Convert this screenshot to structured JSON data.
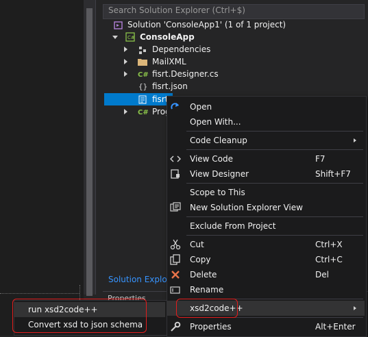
{
  "solution_explorer": {
    "search_placeholder": "Search Solution Explorer (Ctrl+$)",
    "bottom_tab": "Solution Explore",
    "properties_label": "Properties",
    "tree": {
      "solution": "Solution 'ConsoleApp1' (1 of 1 project)",
      "project": "ConsoleApp",
      "dependencies": "Dependencies",
      "mailxml": "MailXML",
      "designer": "fisrt.Designer.cs",
      "json": "fisrt.json",
      "selected": "fisrt",
      "program": "Prog"
    }
  },
  "context_menu": {
    "open": "Open",
    "open_with": "Open With...",
    "code_cleanup": "Code Cleanup",
    "view_code": "View Code",
    "view_code_sc": "F7",
    "view_designer": "View Designer",
    "view_designer_sc": "Shift+F7",
    "scope_to_this": "Scope to This",
    "new_se_view": "New Solution Explorer View",
    "exclude": "Exclude From Project",
    "cut": "Cut",
    "cut_sc": "Ctrl+X",
    "copy": "Copy",
    "copy_sc": "Ctrl+C",
    "delete": "Delete",
    "delete_sc": "Del",
    "rename": "Rename",
    "xsd2code": "xsd2code++",
    "properties": "Properties",
    "properties_sc": "Alt+Enter"
  },
  "submenu": {
    "run": "run xsd2code++",
    "convert": "Convert xsd to json schema"
  },
  "colors": {
    "selection": "#007acc",
    "highlight_box": "#e21d1d",
    "csharp_green": "#8bc34a",
    "folder_yellow": "#dcb67a"
  }
}
